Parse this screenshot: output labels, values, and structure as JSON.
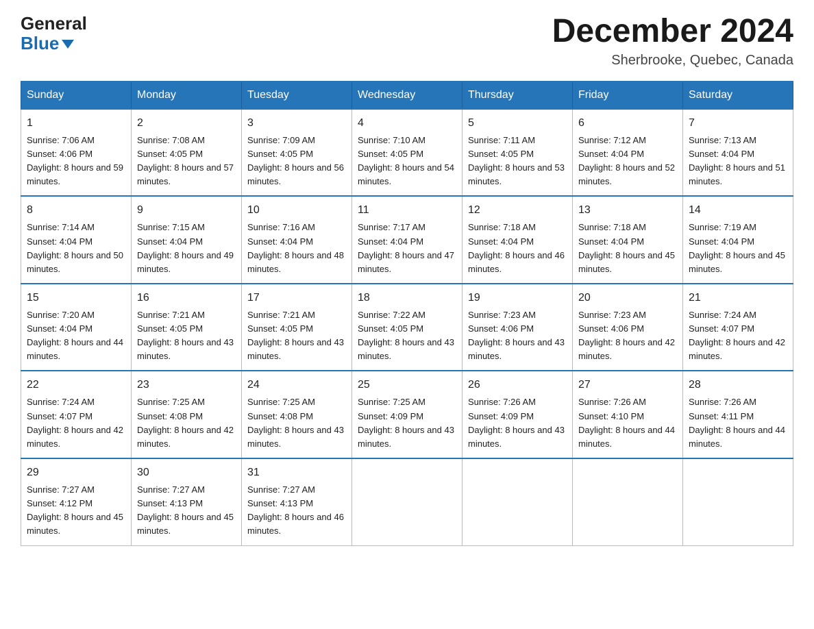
{
  "header": {
    "logo_general": "General",
    "logo_blue": "Blue",
    "month_title": "December 2024",
    "location": "Sherbrooke, Quebec, Canada"
  },
  "days_of_week": [
    "Sunday",
    "Monday",
    "Tuesday",
    "Wednesday",
    "Thursday",
    "Friday",
    "Saturday"
  ],
  "weeks": [
    [
      {
        "day": "1",
        "sunrise": "7:06 AM",
        "sunset": "4:06 PM",
        "daylight": "8 hours and 59 minutes."
      },
      {
        "day": "2",
        "sunrise": "7:08 AM",
        "sunset": "4:05 PM",
        "daylight": "8 hours and 57 minutes."
      },
      {
        "day": "3",
        "sunrise": "7:09 AM",
        "sunset": "4:05 PM",
        "daylight": "8 hours and 56 minutes."
      },
      {
        "day": "4",
        "sunrise": "7:10 AM",
        "sunset": "4:05 PM",
        "daylight": "8 hours and 54 minutes."
      },
      {
        "day": "5",
        "sunrise": "7:11 AM",
        "sunset": "4:05 PM",
        "daylight": "8 hours and 53 minutes."
      },
      {
        "day": "6",
        "sunrise": "7:12 AM",
        "sunset": "4:04 PM",
        "daylight": "8 hours and 52 minutes."
      },
      {
        "day": "7",
        "sunrise": "7:13 AM",
        "sunset": "4:04 PM",
        "daylight": "8 hours and 51 minutes."
      }
    ],
    [
      {
        "day": "8",
        "sunrise": "7:14 AM",
        "sunset": "4:04 PM",
        "daylight": "8 hours and 50 minutes."
      },
      {
        "day": "9",
        "sunrise": "7:15 AM",
        "sunset": "4:04 PM",
        "daylight": "8 hours and 49 minutes."
      },
      {
        "day": "10",
        "sunrise": "7:16 AM",
        "sunset": "4:04 PM",
        "daylight": "8 hours and 48 minutes."
      },
      {
        "day": "11",
        "sunrise": "7:17 AM",
        "sunset": "4:04 PM",
        "daylight": "8 hours and 47 minutes."
      },
      {
        "day": "12",
        "sunrise": "7:18 AM",
        "sunset": "4:04 PM",
        "daylight": "8 hours and 46 minutes."
      },
      {
        "day": "13",
        "sunrise": "7:18 AM",
        "sunset": "4:04 PM",
        "daylight": "8 hours and 45 minutes."
      },
      {
        "day": "14",
        "sunrise": "7:19 AM",
        "sunset": "4:04 PM",
        "daylight": "8 hours and 45 minutes."
      }
    ],
    [
      {
        "day": "15",
        "sunrise": "7:20 AM",
        "sunset": "4:04 PM",
        "daylight": "8 hours and 44 minutes."
      },
      {
        "day": "16",
        "sunrise": "7:21 AM",
        "sunset": "4:05 PM",
        "daylight": "8 hours and 43 minutes."
      },
      {
        "day": "17",
        "sunrise": "7:21 AM",
        "sunset": "4:05 PM",
        "daylight": "8 hours and 43 minutes."
      },
      {
        "day": "18",
        "sunrise": "7:22 AM",
        "sunset": "4:05 PM",
        "daylight": "8 hours and 43 minutes."
      },
      {
        "day": "19",
        "sunrise": "7:23 AM",
        "sunset": "4:06 PM",
        "daylight": "8 hours and 43 minutes."
      },
      {
        "day": "20",
        "sunrise": "7:23 AM",
        "sunset": "4:06 PM",
        "daylight": "8 hours and 42 minutes."
      },
      {
        "day": "21",
        "sunrise": "7:24 AM",
        "sunset": "4:07 PM",
        "daylight": "8 hours and 42 minutes."
      }
    ],
    [
      {
        "day": "22",
        "sunrise": "7:24 AM",
        "sunset": "4:07 PM",
        "daylight": "8 hours and 42 minutes."
      },
      {
        "day": "23",
        "sunrise": "7:25 AM",
        "sunset": "4:08 PM",
        "daylight": "8 hours and 42 minutes."
      },
      {
        "day": "24",
        "sunrise": "7:25 AM",
        "sunset": "4:08 PM",
        "daylight": "8 hours and 43 minutes."
      },
      {
        "day": "25",
        "sunrise": "7:25 AM",
        "sunset": "4:09 PM",
        "daylight": "8 hours and 43 minutes."
      },
      {
        "day": "26",
        "sunrise": "7:26 AM",
        "sunset": "4:09 PM",
        "daylight": "8 hours and 43 minutes."
      },
      {
        "day": "27",
        "sunrise": "7:26 AM",
        "sunset": "4:10 PM",
        "daylight": "8 hours and 44 minutes."
      },
      {
        "day": "28",
        "sunrise": "7:26 AM",
        "sunset": "4:11 PM",
        "daylight": "8 hours and 44 minutes."
      }
    ],
    [
      {
        "day": "29",
        "sunrise": "7:27 AM",
        "sunset": "4:12 PM",
        "daylight": "8 hours and 45 minutes."
      },
      {
        "day": "30",
        "sunrise": "7:27 AM",
        "sunset": "4:13 PM",
        "daylight": "8 hours and 45 minutes."
      },
      {
        "day": "31",
        "sunrise": "7:27 AM",
        "sunset": "4:13 PM",
        "daylight": "8 hours and 46 minutes."
      },
      null,
      null,
      null,
      null
    ]
  ]
}
